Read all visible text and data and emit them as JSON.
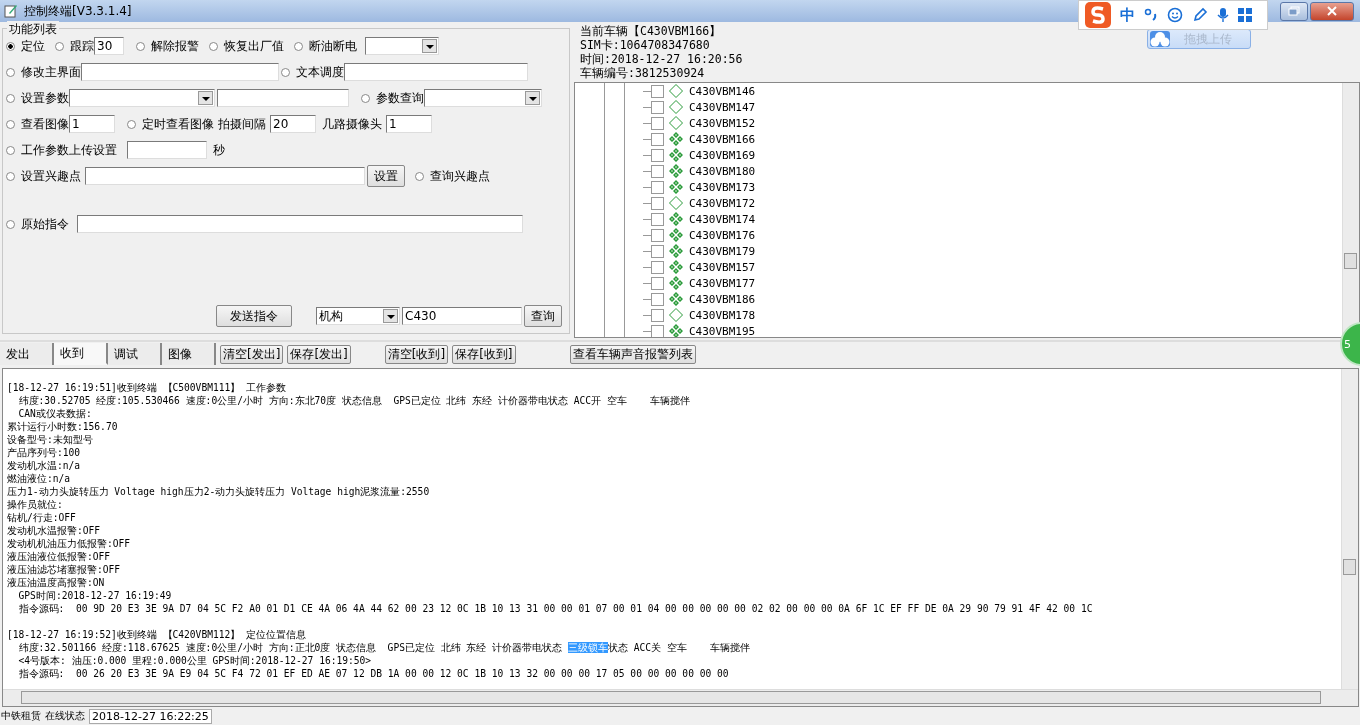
{
  "window": {
    "title": "控制终端[V3.3.1.4]"
  },
  "ime_toolbar": {
    "mode": "中",
    "upload_button": "拖拽上传"
  },
  "function_list": {
    "title": "功能列表",
    "radios": [
      {
        "label": "定位",
        "selected": true
      },
      {
        "label": "跟踪",
        "selected": false
      },
      {
        "label": "解除报警",
        "selected": false
      },
      {
        "label": "恢复出厂值",
        "selected": false
      },
      {
        "label": "断油断电",
        "selected": false
      },
      {
        "label": "修改主界面",
        "selected": false
      },
      {
        "label": "文本调度",
        "selected": false
      },
      {
        "label": "设置参数",
        "selected": false
      },
      {
        "label": "参数查询",
        "selected": false
      },
      {
        "label": "查看图像",
        "selected": false
      },
      {
        "label": "定时查看图像",
        "selected": false
      },
      {
        "label": "工作参数上传设置",
        "selected": false
      },
      {
        "label": "设置兴趣点",
        "selected": false
      },
      {
        "label": "查询兴趣点",
        "selected": false
      },
      {
        "label": "原始指令",
        "selected": false
      }
    ],
    "track_value": "30",
    "image_value": "1",
    "interval_label": "拍摄间隔",
    "interval_value": "20",
    "camera_label": "几路摄像头",
    "camera_value": "1",
    "seconds_unit": "秒",
    "set_button": "设置",
    "send_button": "发送指令",
    "org_select": "机构",
    "search_value": "C430",
    "query_button": "查询"
  },
  "vehicle_info": {
    "current": "当前车辆【C430VBM166】",
    "sim": "SIM卡:1064708347680",
    "time": "时间:2018-12-27 16:20:56",
    "number": "车辆编号:3812530924"
  },
  "vehicle_tree": [
    {
      "name": "C430VBM146",
      "checked": false,
      "online": false
    },
    {
      "name": "C430VBM147",
      "checked": false,
      "online": false
    },
    {
      "name": "C430VBM152",
      "checked": false,
      "online": false
    },
    {
      "name": "C430VBM166",
      "checked": false,
      "online": true
    },
    {
      "name": "C430VBM169",
      "checked": false,
      "online": true
    },
    {
      "name": "C430VBM180",
      "checked": false,
      "online": true
    },
    {
      "name": "C430VBM173",
      "checked": false,
      "online": true
    },
    {
      "name": "C430VBM172",
      "checked": false,
      "online": false
    },
    {
      "name": "C430VBM174",
      "checked": false,
      "online": true
    },
    {
      "name": "C430VBM176",
      "checked": false,
      "online": true
    },
    {
      "name": "C430VBM179",
      "checked": false,
      "online": true
    },
    {
      "name": "C430VBM157",
      "checked": false,
      "online": true
    },
    {
      "name": "C430VBM177",
      "checked": false,
      "online": true
    },
    {
      "name": "C430VBM186",
      "checked": false,
      "online": true
    },
    {
      "name": "C430VBM178",
      "checked": false,
      "online": false
    },
    {
      "name": "C430VBM195",
      "checked": false,
      "online": true
    }
  ],
  "floating_badge": "5",
  "tabs": [
    {
      "label": "发出",
      "selected": false
    },
    {
      "label": "收到",
      "selected": true
    },
    {
      "label": "调试",
      "selected": false
    },
    {
      "label": "图像",
      "selected": false
    }
  ],
  "log_buttons": [
    "清空[发出]",
    "保存[发出]",
    "清空[收到]",
    "保存[收到]",
    "查看车辆声音报警列表"
  ],
  "log": [
    {
      "lines": [
        {
          "text": "[18-12-27 16:19:51]收到终端 【C500VBM111】 工作参数"
        },
        {
          "text": "  纬度:30.52705 经度:105.530466 速度:0公里/小时 方向:东北70度 状态信息  GPS已定位 北纬 东经 计价器带电状态 ACC开 空车    车辆搅伴"
        },
        {
          "text": "  CAN或仪表数据:"
        },
        {
          "text": "累计运行小时数:156.70"
        },
        {
          "text": "设备型号:未知型号"
        },
        {
          "text": "产品序列号:100"
        },
        {
          "text": "发动机水温:n/a"
        },
        {
          "text": "燃油液位:n/a"
        },
        {
          "text": "压力1-动力头旋转压力 Voltage high压力2-动力头旋转压力 Voltage high泥浆流量:2550"
        },
        {
          "text": "操作员就位:"
        },
        {
          "text": "钻机/行走:OFF"
        },
        {
          "text": "发动机水温报警:OFF"
        },
        {
          "text": "发动机机油压力低报警:OFF"
        },
        {
          "text": "液压油液位低报警:OFF"
        },
        {
          "text": "液压油滤芯堵塞报警:OFF"
        },
        {
          "text": "液压油温度高报警:ON"
        },
        {
          "text": "  GPS时间:2018-12-27 16:19:49"
        },
        {
          "text": "  指令源码:  00 9D 20 E3 3E 9A D7 04 5C F2 A0 01 D1 CE 4A 06 4A 44 62 00 23 12 0C 1B 10 13 31 00 00 01 07 00 01 04 00 00 00 00 00 02 02 00 00 00 0A 6F 1C EF FF DE 0A 29 90 79 91 4F 42 00 1C"
        }
      ]
    },
    {
      "lines": [
        {
          "text": "[18-12-27 16:19:52]收到终端 【C420VBM112】 定位位置信息"
        },
        {
          "text": "  纬度:32.501166 经度:118.67625 速度:0公里/小时 方向:正北0度 状态信息  GPS已定位 北纬 东经 计价器带电状态 ",
          "highlight": "三级锁车",
          "after": "状态 ACC关 空车    车辆搅伴"
        },
        {
          "text": "  <4号版本: 油压:0.000 里程:0.000公里 GPS时间:2018-12-27 16:19:50>"
        },
        {
          "text": "  指令源码:  00 26 20 E3 3E 9A E9 04 5C F4 72 01 EF ED AE 07 12 DB 1A 00 00 12 0C 1B 10 13 32 00 00 00 17 05 00 00 00 00 00 00"
        }
      ]
    }
  ],
  "status_bar": [
    "中铁租赁",
    "在线状态",
    "2018-12-27 16:22:25"
  ]
}
